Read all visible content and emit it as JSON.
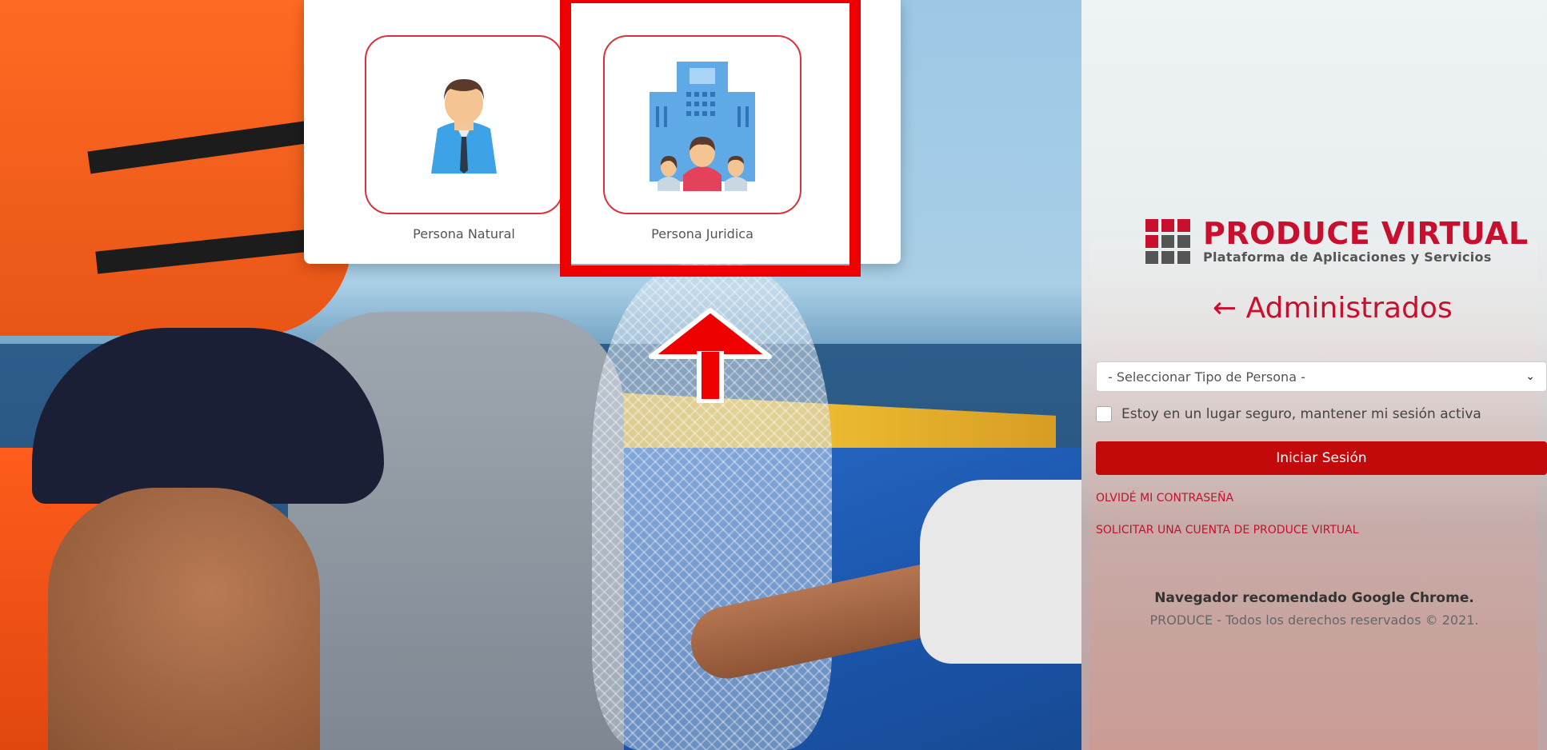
{
  "picker": {
    "options": [
      {
        "label": "Persona Natural",
        "icon": "person-natural-icon"
      },
      {
        "label": "Persona Juridica",
        "icon": "organization-icon"
      }
    ],
    "accent_color": "#d9323c"
  },
  "annotation": {
    "highlight_color": "#ee0000",
    "arrow_color": "#ee0000"
  },
  "login": {
    "brand_title": "PRODUCE VIRTUAL",
    "brand_subtitle": "Plataforma de Aplicaciones y Servicios",
    "back_title": "← Administrados",
    "select_placeholder": "- Seleccionar Tipo de Persona -",
    "remember_label": "Estoy en un lugar seguro, mantener mi sesión activa",
    "submit_label": "Iniciar Sesión",
    "forgot_link": "OLVIDÉ MI CONTRASEÑA",
    "request_link": "SOLICITAR UNA CUENTA DE PRODUCE VIRTUAL",
    "browser_note": "Navegador recomendado Google Chrome.",
    "copyright": "PRODUCE - Todos los derechos reservados © 2021.",
    "brand_color": "#c8102e",
    "button_color": "#c20a0a"
  }
}
